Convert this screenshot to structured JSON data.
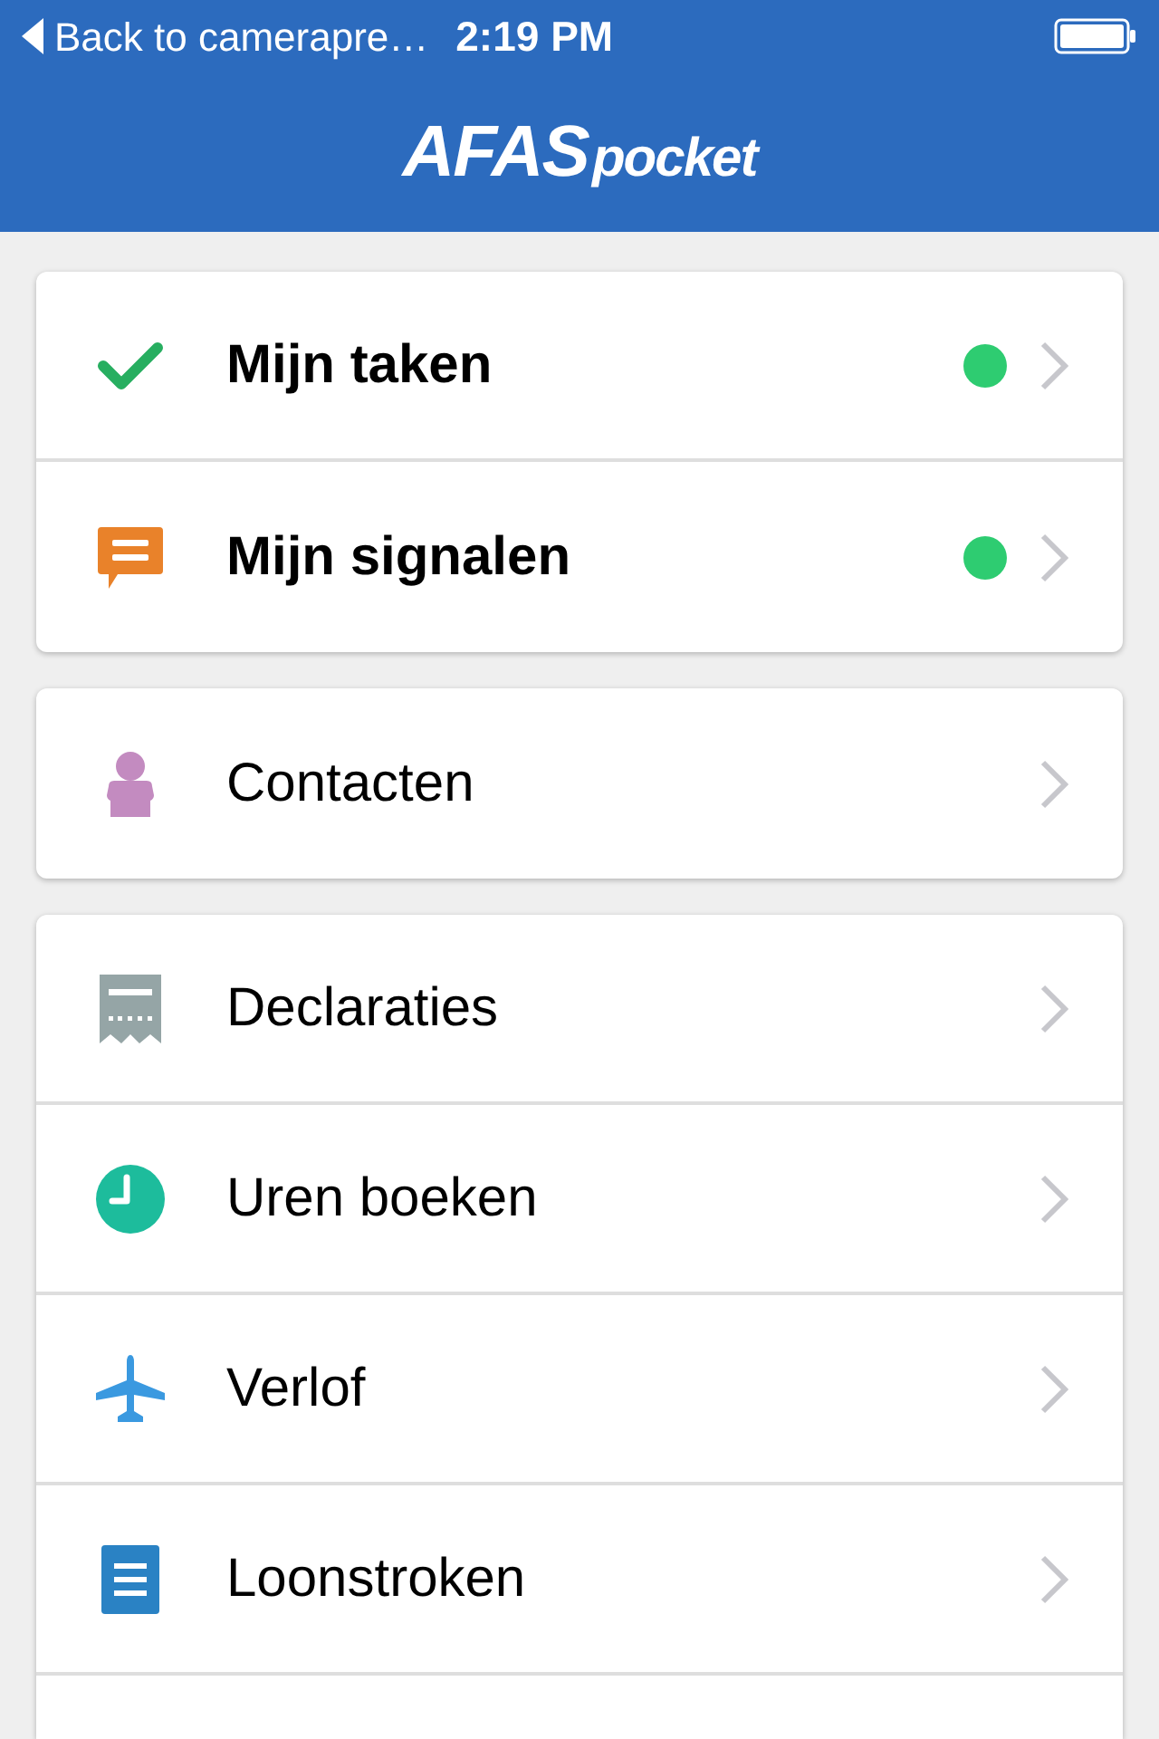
{
  "status_bar": {
    "back_label": "Back to camerapre…",
    "time": "2:19 PM"
  },
  "header": {
    "logo": {
      "brand": "AFAS",
      "product": "pocket"
    }
  },
  "groups": [
    {
      "items": [
        {
          "label": "Mijn taken",
          "unread": true
        },
        {
          "label": "Mijn signalen",
          "unread": true
        }
      ]
    },
    {
      "items": [
        {
          "label": "Contacten",
          "unread": false
        }
      ]
    },
    {
      "items": [
        {
          "label": "Declaraties",
          "unread": false
        },
        {
          "label": "Uren boeken",
          "unread": false
        },
        {
          "label": "Verlof",
          "unread": false
        },
        {
          "label": "Loonstroken",
          "unread": false
        }
      ]
    }
  ]
}
